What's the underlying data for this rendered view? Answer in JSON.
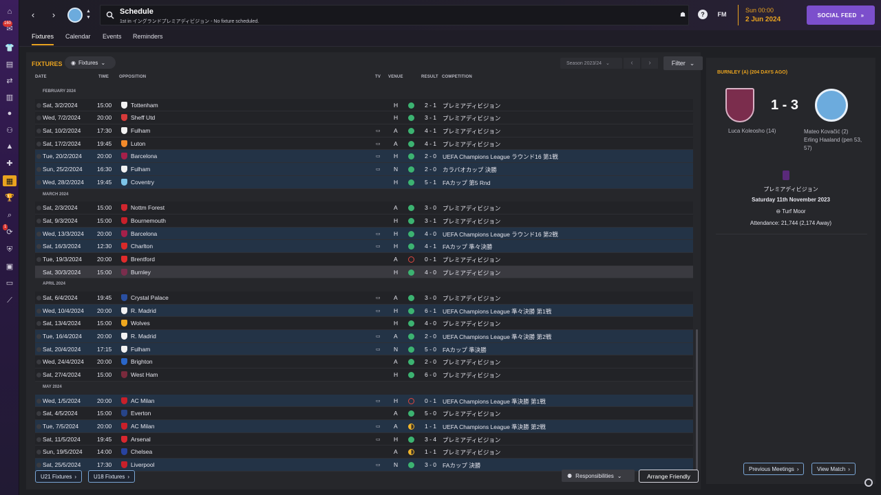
{
  "header": {
    "title": "Schedule",
    "subtitle": "1st in イングランドプレミアディビジョン - No fixture scheduled.",
    "fm_label": "FM",
    "time": "Sun 00:00",
    "date": "2 Jun 2024",
    "social_feed": "SOCIAL FEED"
  },
  "rail_badges": {
    "inbox": "160",
    "transfers": "1"
  },
  "tabs": [
    {
      "label": "Fixtures"
    },
    {
      "label": "Calendar"
    },
    {
      "label": "Events"
    },
    {
      "label": "Reminders"
    }
  ],
  "panel": {
    "title": "FIXTURES",
    "view_dropdown": "Fixtures",
    "season": "Season 2023/24",
    "filter": "Filter"
  },
  "columns": {
    "date": "DATE",
    "time": "TIME",
    "opposition": "OPPOSITION",
    "tv": "TV",
    "venue": "VENUE",
    "result": "RESULT",
    "competition": "COMPETITION"
  },
  "rows": [
    {
      "kind": "month",
      "label": "FEBRUARY 2024"
    },
    {
      "kind": "fixture",
      "style": "",
      "date": "Sat, 3/2/2024",
      "time": "15:00",
      "opp": "Tottenham",
      "crest": "#f2f2f2",
      "tv": false,
      "venue": "H",
      "res": "win",
      "score": "2 - 1",
      "comp": "プレミアディビジョン"
    },
    {
      "kind": "fixture",
      "style": "",
      "date": "Wed, 7/2/2024",
      "time": "20:00",
      "opp": "Sheff Utd",
      "crest": "#d63a3a",
      "tv": false,
      "venue": "H",
      "res": "win",
      "score": "3 - 1",
      "comp": "プレミアディビジョン"
    },
    {
      "kind": "fixture",
      "style": "",
      "date": "Sat, 10/2/2024",
      "time": "17:30",
      "opp": "Fulham",
      "crest": "#f2f2f2",
      "tv": true,
      "venue": "A",
      "res": "win",
      "score": "4 - 1",
      "comp": "プレミアディビジョン"
    },
    {
      "kind": "fixture",
      "style": "",
      "date": "Sat, 17/2/2024",
      "time": "19:45",
      "opp": "Luton",
      "crest": "#f28a2a",
      "tv": true,
      "venue": "A",
      "res": "win",
      "score": "4 - 1",
      "comp": "プレミアディビジョン"
    },
    {
      "kind": "fixture",
      "style": "blue",
      "date": "Tue, 20/2/2024",
      "time": "20:00",
      "opp": "Barcelona",
      "crest": "#a5204a",
      "tv": true,
      "venue": "H",
      "res": "win",
      "score": "2 - 0",
      "comp": "UEFA Champions League ラウンド16 第1戦"
    },
    {
      "kind": "fixture",
      "style": "blue",
      "date": "Sun, 25/2/2024",
      "time": "16:30",
      "opp": "Fulham",
      "crest": "#f2f2f2",
      "tv": true,
      "venue": "N",
      "res": "win",
      "score": "2 - 0",
      "comp": "カラバオカップ 決勝"
    },
    {
      "kind": "fixture",
      "style": "blue",
      "date": "Wed, 28/2/2024",
      "time": "19:45",
      "opp": "Coventry",
      "crest": "#7cc4e8",
      "tv": false,
      "venue": "H",
      "res": "win",
      "score": "5 - 1",
      "comp": "FAカップ 第5 Rnd"
    },
    {
      "kind": "month",
      "label": "MARCH 2024"
    },
    {
      "kind": "fixture",
      "style": "",
      "date": "Sat, 2/3/2024",
      "time": "15:00",
      "opp": "Nottm Forest",
      "crest": "#d0262e",
      "tv": false,
      "venue": "A",
      "res": "win",
      "score": "3 - 0",
      "comp": "プレミアディビジョン"
    },
    {
      "kind": "fixture",
      "style": "",
      "date": "Sat, 9/3/2024",
      "time": "15:00",
      "opp": "Bournemouth",
      "crest": "#c8202a",
      "tv": false,
      "venue": "H",
      "res": "win",
      "score": "3 - 1",
      "comp": "プレミアディビジョン"
    },
    {
      "kind": "fixture",
      "style": "blue",
      "date": "Wed, 13/3/2024",
      "time": "20:00",
      "opp": "Barcelona",
      "crest": "#a5204a",
      "tv": true,
      "venue": "H",
      "res": "win",
      "score": "4 - 0",
      "comp": "UEFA Champions League ラウンド16 第2戦"
    },
    {
      "kind": "fixture",
      "style": "blue",
      "date": "Sat, 16/3/2024",
      "time": "12:30",
      "opp": "Charlton",
      "crest": "#d82a2a",
      "tv": true,
      "venue": "H",
      "res": "win",
      "score": "4 - 1",
      "comp": "FAカップ 準々決勝"
    },
    {
      "kind": "fixture",
      "style": "",
      "date": "Tue, 19/3/2024",
      "time": "20:00",
      "opp": "Brentford",
      "crest": "#e02b2b",
      "tv": false,
      "venue": "A",
      "res": "loss",
      "score": "0 - 1",
      "comp": "プレミアディビジョン"
    },
    {
      "kind": "fixture",
      "style": "hl",
      "date": "Sat, 30/3/2024",
      "time": "15:00",
      "opp": "Burnley",
      "crest": "#7b2d4d",
      "tv": false,
      "venue": "H",
      "res": "win",
      "score": "4 - 0",
      "comp": "プレミアディビジョン"
    },
    {
      "kind": "month",
      "label": "APRIL 2024"
    },
    {
      "kind": "fixture",
      "style": "",
      "date": "Sat, 6/4/2024",
      "time": "19:45",
      "opp": "Crystal Palace",
      "crest": "#2a4fa0",
      "tv": true,
      "venue": "A",
      "res": "win",
      "score": "3 - 0",
      "comp": "プレミアディビジョン"
    },
    {
      "kind": "fixture",
      "style": "blue",
      "date": "Wed, 10/4/2024",
      "time": "20:00",
      "opp": "R. Madrid",
      "crest": "#f2f2f2",
      "tv": true,
      "venue": "H",
      "res": "win",
      "score": "6 - 1",
      "comp": "UEFA Champions League 準々決勝 第1戦"
    },
    {
      "kind": "fixture",
      "style": "",
      "date": "Sat, 13/4/2024",
      "time": "15:00",
      "opp": "Wolves",
      "crest": "#f0a81e",
      "tv": false,
      "venue": "H",
      "res": "win",
      "score": "4 - 0",
      "comp": "プレミアディビジョン"
    },
    {
      "kind": "fixture",
      "style": "blue",
      "date": "Tue, 16/4/2024",
      "time": "20:00",
      "opp": "R. Madrid",
      "crest": "#f2f2f2",
      "tv": true,
      "venue": "A",
      "res": "win",
      "score": "2 - 0",
      "comp": "UEFA Champions League 準々決勝 第2戦"
    },
    {
      "kind": "fixture",
      "style": "blue",
      "date": "Sat, 20/4/2024",
      "time": "17:15",
      "opp": "Fulham",
      "crest": "#f2f2f2",
      "tv": true,
      "venue": "N",
      "res": "win",
      "score": "5 - 0",
      "comp": "FAカップ 準決勝"
    },
    {
      "kind": "fixture",
      "style": "",
      "date": "Wed, 24/4/2024",
      "time": "20:00",
      "opp": "Brighton",
      "crest": "#2a66c8",
      "tv": false,
      "venue": "A",
      "res": "win",
      "score": "2 - 0",
      "comp": "プレミアディビジョン"
    },
    {
      "kind": "fixture",
      "style": "",
      "date": "Sat, 27/4/2024",
      "time": "15:00",
      "opp": "West Ham",
      "crest": "#7a2a3c",
      "tv": false,
      "venue": "H",
      "res": "win",
      "score": "6 - 0",
      "comp": "プレミアディビジョン"
    },
    {
      "kind": "month",
      "label": "MAY 2024"
    },
    {
      "kind": "fixture",
      "style": "blue",
      "date": "Wed, 1/5/2024",
      "time": "20:00",
      "opp": "AC Milan",
      "crest": "#c8202a",
      "tv": true,
      "venue": "H",
      "res": "loss",
      "score": "0 - 1",
      "comp": "UEFA Champions League 準決勝 第1戦"
    },
    {
      "kind": "fixture",
      "style": "",
      "date": "Sat, 4/5/2024",
      "time": "15:00",
      "opp": "Everton",
      "crest": "#274488",
      "tv": false,
      "venue": "A",
      "res": "win",
      "score": "5 - 0",
      "comp": "プレミアディビジョン"
    },
    {
      "kind": "fixture",
      "style": "blue",
      "date": "Tue, 7/5/2024",
      "time": "20:00",
      "opp": "AC Milan",
      "crest": "#c8202a",
      "tv": true,
      "venue": "A",
      "res": "draw",
      "score": "1 - 1",
      "comp": "UEFA Champions League 準決勝 第2戦"
    },
    {
      "kind": "fixture",
      "style": "",
      "date": "Sat, 11/5/2024",
      "time": "19:45",
      "opp": "Arsenal",
      "crest": "#d8272f",
      "tv": true,
      "venue": "H",
      "res": "win",
      "score": "3 - 4",
      "comp": "プレミアディビジョン"
    },
    {
      "kind": "fixture",
      "style": "",
      "date": "Sun, 19/5/2024",
      "time": "14:00",
      "opp": "Chelsea",
      "crest": "#2843a0",
      "tv": false,
      "venue": "A",
      "res": "draw",
      "score": "1 - 1",
      "comp": "プレミアディビジョン"
    },
    {
      "kind": "fixture",
      "style": "blue",
      "date": "Sat, 25/5/2024",
      "time": "17:30",
      "opp": "Liverpool",
      "crest": "#c8202a",
      "tv": true,
      "venue": "N",
      "res": "win",
      "score": "3 - 0",
      "comp": "FAカップ 決勝"
    }
  ],
  "footer": {
    "u21": "U21 Fixtures",
    "u18": "U18 Fixtures",
    "responsibilities": "Responsibilities",
    "arrange_friendly": "Arrange Friendly"
  },
  "side": {
    "title": "BURNLEY (A) (204 DAYS AGO)",
    "score": "1 - 3",
    "home_scorers": "Luca Koleosho (14)",
    "away_scorers_1": "Mateo Kovačić (2)",
    "away_scorers_2": "Erling Haaland (pen 53,",
    "away_scorers_3": "57)",
    "competition": "プレミアディビジョン",
    "match_date": "Saturday 11th November 2023",
    "stadium": "Turf Moor",
    "attendance": "Attendance: 21,744 (2,174 Away)",
    "prev_meetings": "Previous Meetings",
    "view_match": "View Match"
  },
  "colors": {
    "accent": "#e9a31f",
    "win": "#3cb371",
    "loss": "#e0473f",
    "draw": "#f0b52b",
    "social": "#7c4fcc"
  }
}
